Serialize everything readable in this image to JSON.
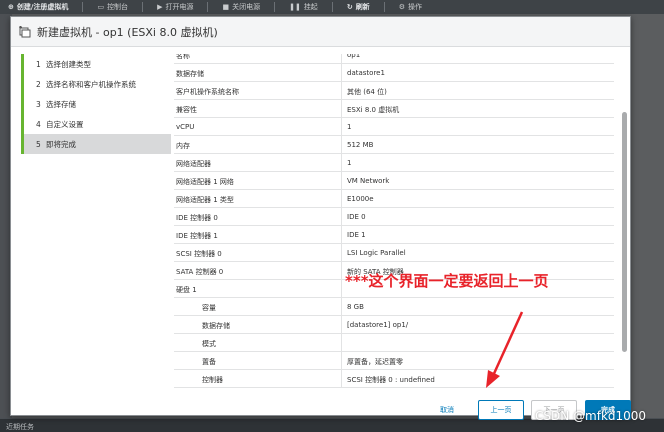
{
  "toolbar": {
    "items": [
      "创建/注册虚拟机",
      "控制台",
      "打开电源",
      "关闭电源",
      "挂起",
      "刷新",
      "操作"
    ]
  },
  "bottom_bar": {
    "label": "近期任务"
  },
  "dialog": {
    "title": "新建虚拟机 - op1 (ESXi 8.0 虚拟机)"
  },
  "steps": [
    {
      "num": "1",
      "label": "选择创建类型"
    },
    {
      "num": "2",
      "label": "选择名称和客户机操作系统"
    },
    {
      "num": "3",
      "label": "选择存储"
    },
    {
      "num": "4",
      "label": "自定义设置"
    },
    {
      "num": "5",
      "label": "即将完成",
      "active": true
    }
  ],
  "summary_rows": [
    {
      "key": "名称",
      "value": "op1"
    },
    {
      "key": "数据存储",
      "value": "datastore1"
    },
    {
      "key": "客户机操作系统名称",
      "value": "其他 (64 位)"
    },
    {
      "key": "兼容性",
      "value": "ESXi 8.0 虚拟机"
    },
    {
      "key": "vCPU",
      "value": "1"
    },
    {
      "key": "内存",
      "value": "512 MB"
    },
    {
      "key": "网络适配器",
      "value": "1"
    },
    {
      "key": "网络适配器 1 网络",
      "value": "VM Network"
    },
    {
      "key": "网络适配器 1 类型",
      "value": "E1000e"
    },
    {
      "key": "IDE 控制器 0",
      "value": "IDE 0"
    },
    {
      "key": "IDE 控制器 1",
      "value": "IDE 1"
    },
    {
      "key": "SCSI 控制器 0",
      "value": "LSI Logic Parallel"
    },
    {
      "key": "SATA 控制器 0",
      "value": "新的 SATA 控制器"
    },
    {
      "key": "硬盘 1",
      "value": ""
    },
    {
      "key": "容量",
      "value": "8 GB",
      "sub": true
    },
    {
      "key": "数据存储",
      "value": "[datastore1] op1/",
      "sub": true
    },
    {
      "key": "模式",
      "value": "",
      "sub": true
    },
    {
      "key": "置备",
      "value": "厚置备，延迟置零",
      "sub": true
    },
    {
      "key": "控制器",
      "value": "SCSI 控制器 0 : undefined",
      "sub": true
    }
  ],
  "annotation": {
    "text": "***这个界面一定要返回上一页",
    "color": "#e8232a"
  },
  "buttons": {
    "cancel": "取消",
    "back": "上一页",
    "next": "下一页",
    "finish": "完成"
  },
  "watermark": "CSDN @mfkd1000",
  "colors": {
    "accent": "#0079b8",
    "step_bar": "#67b530",
    "annotation": "#e8232a"
  }
}
